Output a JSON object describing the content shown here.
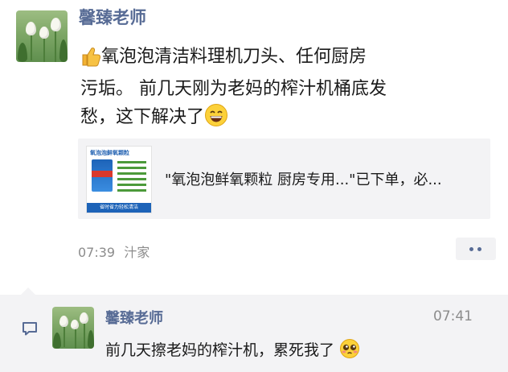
{
  "post": {
    "author": "馨臻老师",
    "text_line1": "氧泡泡清洁料理机刀头、任何厨房",
    "text_line2": "污垢。 前几天刚为老妈的榨汁机桶底发",
    "text_line3": "愁，这下解决了",
    "leading_icon": "thumbs-up-emoji",
    "trailing_icon": "grinning-face-emoji",
    "timestamp": "07:39",
    "source_action": "汁家"
  },
  "link_card": {
    "title": "\"氧泡泡鲜氧颗粒 厨房专用...\"已下单，必...",
    "thumb_header": "氧泡泡鲜氧颗粒",
    "thumb_footer": "省时省力轻松清洁"
  },
  "comment": {
    "author": "馨臻老师",
    "time": "07:41",
    "text": "前几天擦老妈的榨汁机，累死我了",
    "icon": "comment-bubble-icon",
    "emoji": "pleading-face-emoji"
  },
  "colors": {
    "name_blue": "#576b95",
    "meta_gray": "#8c8c8c",
    "card_bg": "#f3f3f5"
  }
}
